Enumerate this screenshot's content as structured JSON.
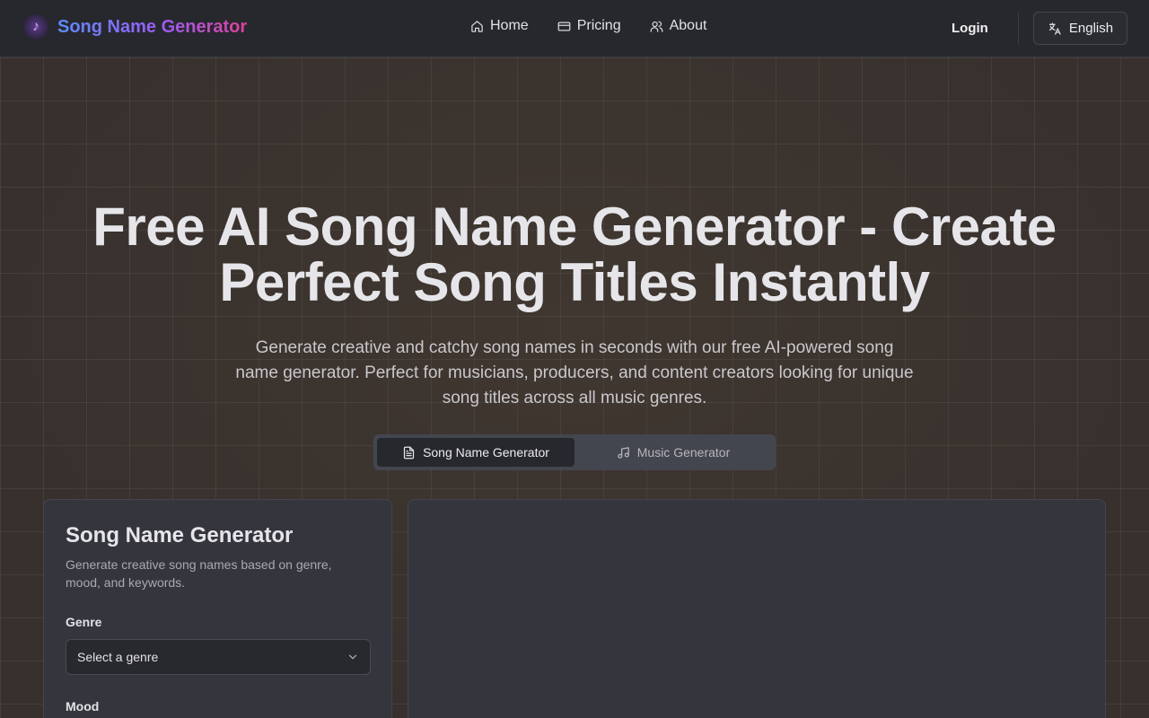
{
  "header": {
    "brand_name": "Song Name Generator",
    "nav": [
      {
        "label": "Home",
        "icon": "home-icon"
      },
      {
        "label": "Pricing",
        "icon": "card-icon"
      },
      {
        "label": "About",
        "icon": "users-icon"
      }
    ],
    "login_label": "Login",
    "language_label": "English"
  },
  "hero": {
    "title_line1": "Free AI Song Name Generator - Create",
    "title_line2": "Perfect Song Titles Instantly",
    "subtitle": "Generate creative and catchy song names in seconds with our free AI-powered song name generator. Perfect for musicians, producers, and content creators looking for unique song titles across all music genres."
  },
  "tabs": [
    {
      "label": "Song Name Generator",
      "icon": "document-icon",
      "active": true
    },
    {
      "label": "Music Generator",
      "icon": "music-note-icon",
      "active": false
    }
  ],
  "form": {
    "title": "Song Name Generator",
    "description": "Generate creative song names based on genre, mood, and keywords.",
    "genre_label": "Genre",
    "genre_placeholder": "Select a genre",
    "mood_label": "Mood"
  },
  "colors": {
    "brand_gradient": [
      "#5b8cff",
      "#9b5cf6",
      "#e0409a"
    ],
    "header_bg": "#27282d",
    "card_bg": "#35363d"
  }
}
